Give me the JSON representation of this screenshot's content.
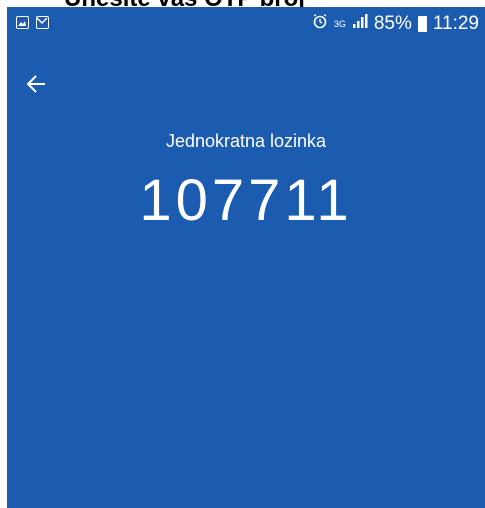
{
  "caption": {
    "text": "Unesite vaš OTP broj"
  },
  "statusbar": {
    "left_icons": [
      "image-icon",
      "mail-icon"
    ],
    "alarm_icon": "alarm-clock-icon",
    "network": "3G",
    "signal_icon": "signal-bars-icon",
    "battery_percent": "85%",
    "battery_icon": "battery-icon",
    "time": "11:29"
  },
  "header": {
    "back_icon": "arrow-left-icon"
  },
  "main": {
    "label": "Jednokratna lozinka",
    "code": "107711"
  },
  "colors": {
    "screen_background": "#1b5cb0",
    "text": "#ffffff"
  }
}
